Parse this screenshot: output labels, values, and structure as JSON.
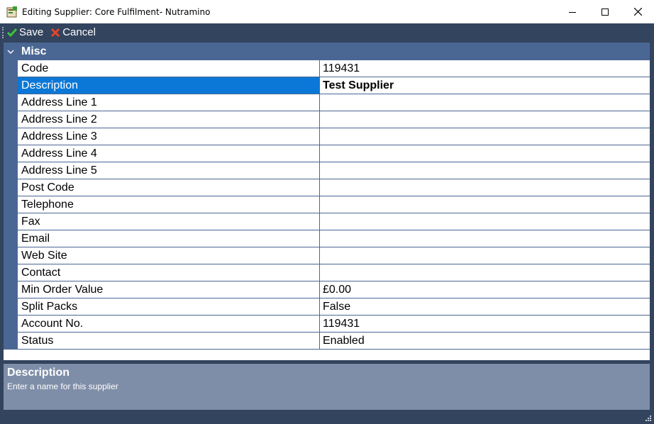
{
  "window": {
    "title": "Editing Supplier: Core Fulfilment- Nutramino",
    "controls": [
      "minimize",
      "maximize",
      "close"
    ]
  },
  "toolbar": {
    "save_label": "Save",
    "cancel_label": "Cancel"
  },
  "category": {
    "title": "Misc"
  },
  "properties": [
    {
      "label": "Code",
      "value": "119431"
    },
    {
      "label": "Description",
      "value": "Test Supplier"
    },
    {
      "label": "Address Line 1",
      "value": ""
    },
    {
      "label": "Address Line 2",
      "value": ""
    },
    {
      "label": "Address Line 3",
      "value": ""
    },
    {
      "label": "Address Line 4",
      "value": ""
    },
    {
      "label": "Address Line 5",
      "value": ""
    },
    {
      "label": "Post Code",
      "value": ""
    },
    {
      "label": "Telephone",
      "value": ""
    },
    {
      "label": "Fax",
      "value": ""
    },
    {
      "label": "Email",
      "value": ""
    },
    {
      "label": "Web Site",
      "value": ""
    },
    {
      "label": "Contact",
      "value": ""
    },
    {
      "label": "Min Order Value",
      "value": "£0.00"
    },
    {
      "label": "Split Packs",
      "value": "False"
    },
    {
      "label": "Account No.",
      "value": "119431"
    },
    {
      "label": "Status",
      "value": "Enabled"
    }
  ],
  "help": {
    "title": "Description",
    "text": "Enter a name for this supplier"
  },
  "colors": {
    "selected": "#0b78d7",
    "category": "#4a6794",
    "chrome": "#33445e",
    "help_panel": "#7f8ea8"
  }
}
